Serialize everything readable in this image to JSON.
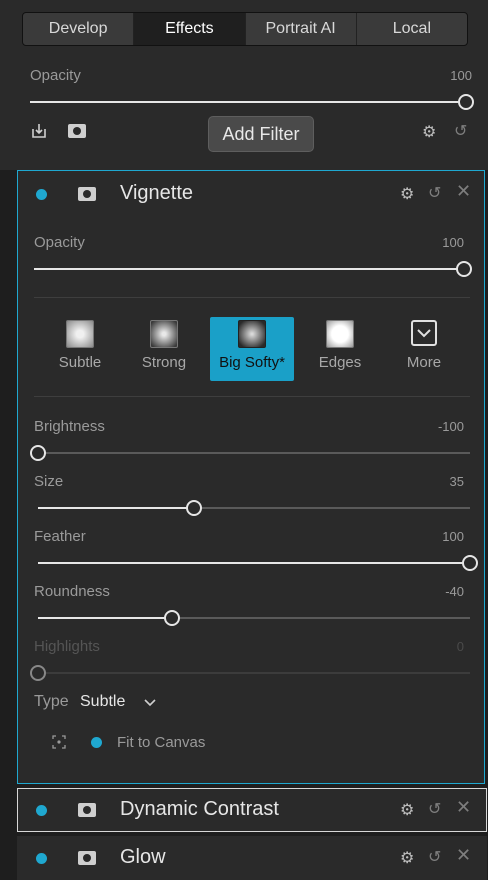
{
  "tabs": [
    {
      "label": "Develop",
      "active": false
    },
    {
      "label": "Effects",
      "active": true
    },
    {
      "label": "Portrait AI",
      "active": false
    },
    {
      "label": "Local",
      "active": false
    }
  ],
  "top": {
    "opacity_label": "Opacity",
    "opacity_value": "100",
    "opacity_level": 1.0,
    "add_filter": "Add Filter"
  },
  "vignette": {
    "title": "Vignette",
    "opacity_label": "Opacity",
    "opacity_value": "100",
    "opacity_level": 1.0,
    "presets": [
      {
        "label": "Subtle",
        "selected": false
      },
      {
        "label": "Strong",
        "selected": false
      },
      {
        "label": "Big Softy*",
        "selected": true
      },
      {
        "label": "Edges",
        "selected": false
      },
      {
        "label": "More",
        "selected": false
      }
    ],
    "sliders": [
      {
        "label": "Brightness",
        "value": "-100",
        "level": 0.0,
        "dim": false
      },
      {
        "label": "Size",
        "value": "35",
        "level": 0.36,
        "dim": false
      },
      {
        "label": "Feather",
        "value": "100",
        "level": 1.0,
        "dim": false
      },
      {
        "label": "Roundness",
        "value": "-40",
        "level": 0.31,
        "dim": false
      },
      {
        "label": "Highlights",
        "value": "0",
        "level": 0.0,
        "dim": true
      }
    ],
    "type_label": "Type",
    "type_value": "Subtle",
    "fit_label": "Fit to Canvas"
  },
  "filters": [
    {
      "title": "Dynamic Contrast"
    },
    {
      "title": "Glow"
    }
  ],
  "colors": {
    "accent": "#1fa8d0",
    "panel": "#2a2a2a",
    "selected_preset": "#1aa0c8"
  }
}
